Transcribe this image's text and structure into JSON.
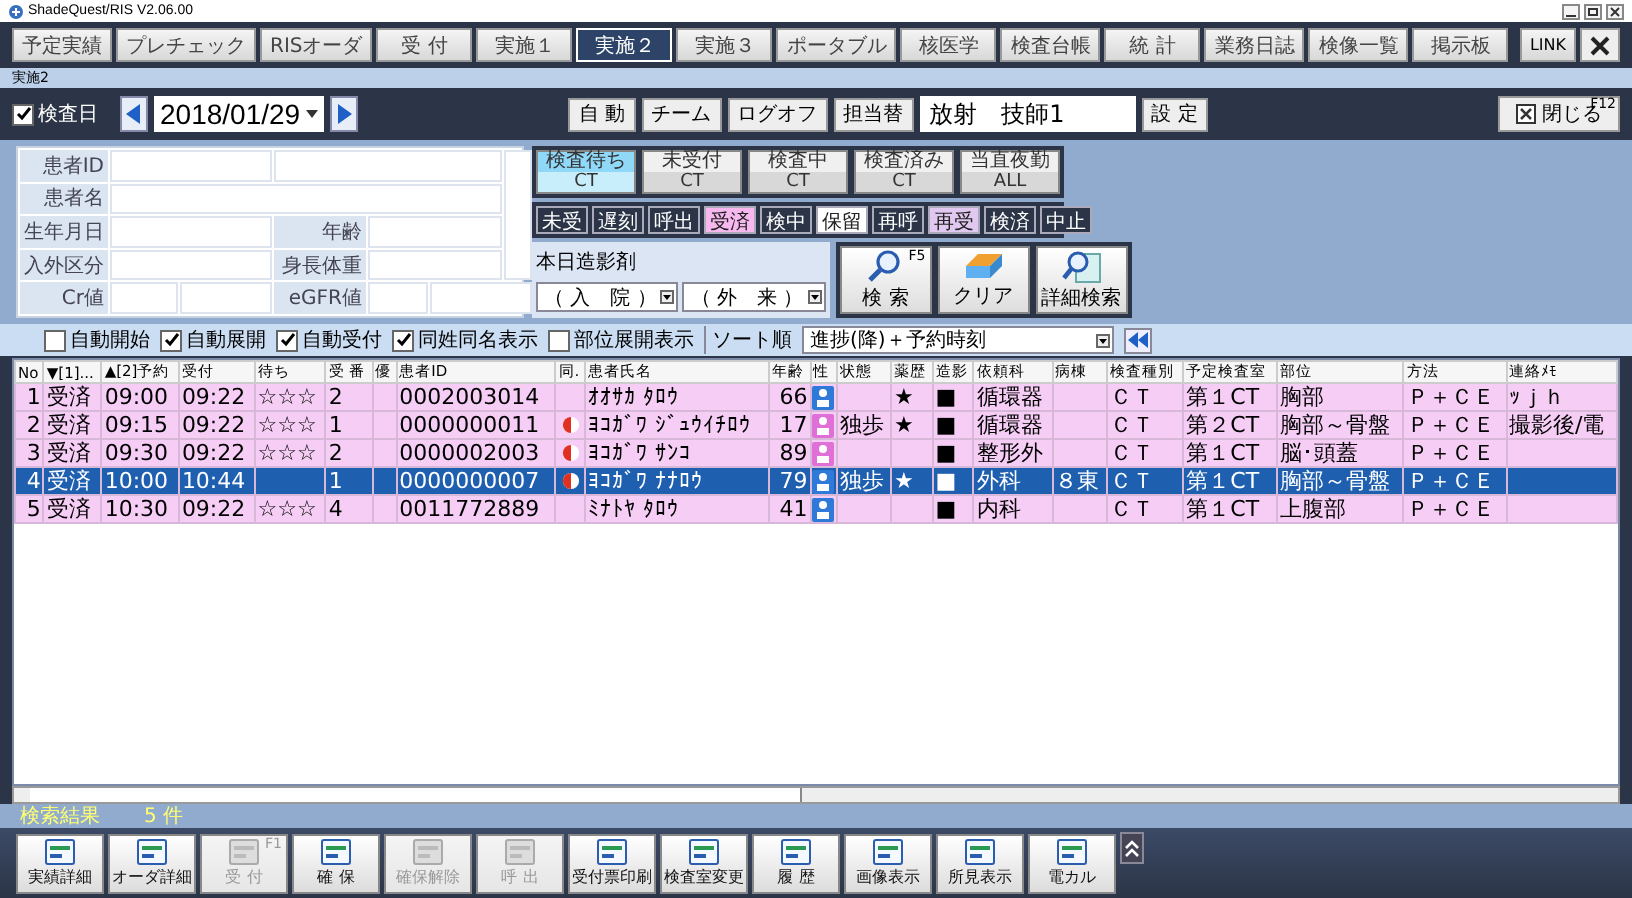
{
  "window": {
    "title": "ShadeQuest/RIS V2.06.00"
  },
  "nav_tabs": [
    {
      "label": "予定実績",
      "selected": false
    },
    {
      "label": "プレチェック",
      "selected": false
    },
    {
      "label": "RISオーダ",
      "selected": false
    },
    {
      "label": "受 付",
      "selected": false
    },
    {
      "label": "実施１",
      "selected": false
    },
    {
      "label": "実施２",
      "selected": true
    },
    {
      "label": "実施３",
      "selected": false
    },
    {
      "label": "ポータブル",
      "selected": false
    },
    {
      "label": "核医学",
      "selected": false
    },
    {
      "label": "検査台帳",
      "selected": false
    },
    {
      "label": "統 計",
      "selected": false
    },
    {
      "label": "業務日誌",
      "selected": false
    },
    {
      "label": "検像一覧",
      "selected": false
    },
    {
      "label": "掲示板",
      "selected": false
    }
  ],
  "link_button": "LINK",
  "screen_title": "実施2",
  "toolbar": {
    "date_checkbox": {
      "label": "検査日",
      "checked": true
    },
    "date": "2018/01/29",
    "buttons": [
      "自 動",
      "チーム",
      "ログオフ",
      "担当替"
    ],
    "operator": "放射　技師1",
    "settings_button": "設 定",
    "close_button": {
      "label": "閉じる",
      "shortcut": "F12"
    }
  },
  "patient_form": {
    "fields": [
      "患者ID",
      "患者名",
      "生年月日",
      "年齢",
      "入外区分",
      "身長体重",
      "Cr値",
      "eGFR値"
    ]
  },
  "status_buttons": [
    {
      "label": "検査待ち",
      "sub": "CT",
      "selected": true
    },
    {
      "label": "未受付",
      "sub": "CT",
      "selected": false
    },
    {
      "label": "検査中",
      "sub": "CT",
      "selected": false
    },
    {
      "label": "検査済み",
      "sub": "CT",
      "selected": false
    },
    {
      "label": "当直夜勤",
      "sub": "ALL",
      "selected": false
    }
  ],
  "filter_buttons": [
    {
      "label": "未受",
      "color": "#2b3547"
    },
    {
      "label": "遅刻",
      "color": "#2b3547"
    },
    {
      "label": "呼出",
      "color": "#2b3547"
    },
    {
      "label": "受済",
      "color": "#f7b8f0"
    },
    {
      "label": "検中",
      "color": "#2b3547"
    },
    {
      "label": "保留",
      "color": "#ffffff"
    },
    {
      "label": "再呼",
      "color": "#2b3547"
    },
    {
      "label": "再受",
      "color": "#e0c8f0"
    },
    {
      "label": "検済",
      "color": "#2b3547"
    },
    {
      "label": "中止",
      "color": "#2b3547"
    }
  ],
  "contrast": {
    "label": "本日造影剤",
    "selects": [
      "（ 入　院 ）",
      "（ 外　来 ）"
    ]
  },
  "search_buttons": [
    {
      "label": "検 索",
      "shortcut": "F5"
    },
    {
      "label": "クリア"
    },
    {
      "label": "詳細検索"
    }
  ],
  "options": [
    {
      "label": "自動開始",
      "checked": false
    },
    {
      "label": "自動展開",
      "checked": true
    },
    {
      "label": "自動受付",
      "checked": true
    },
    {
      "label": "同姓同名表示",
      "checked": true
    },
    {
      "label": "部位展開表示",
      "checked": false
    }
  ],
  "sort": {
    "label": "ソート順",
    "value": "進捗(降)＋予約時刻"
  },
  "table": {
    "columns": [
      "No",
      "▼[1]...",
      "▲[2]予約",
      "受付",
      "待ち",
      "受 番",
      "優",
      "患者ID",
      "同.",
      "患者氏名",
      "年齢",
      "性",
      "状態",
      "薬歴",
      "造影",
      "依頼科",
      "病棟",
      "検査種別",
      "予定検査室",
      "部位",
      "方法",
      "連絡ﾒﾓ"
    ],
    "rows": [
      {
        "no": "1",
        "progress": "受済",
        "reserved": "09:00",
        "received": "09:22",
        "wait": "☆☆☆",
        "number": "2",
        "patient_id": "0002003014",
        "same_name": false,
        "name": "ｵｵｻｶ ﾀﾛｳ",
        "age": "66",
        "kind": "male",
        "state": "",
        "drug_history": "★",
        "contrast": "■",
        "dept": "循環器",
        "ward": "",
        "modality": "ＣＴ",
        "room": "第１CT",
        "region": "胸部",
        "method": "Ｐ＋ＣＥ",
        "note": "ｯｊｈ",
        "selected": false
      },
      {
        "no": "2",
        "progress": "受済",
        "reserved": "09:15",
        "received": "09:22",
        "wait": "☆☆☆",
        "number": "1",
        "patient_id": "0000000011",
        "same_name": true,
        "name": "ﾖｺｶﾞﾜ ｼﾞｭｳｲﾁﾛｳ",
        "age": "17",
        "kind": "female",
        "state": "独歩",
        "drug_history": "★",
        "contrast": "■",
        "dept": "循環器",
        "ward": "",
        "modality": "ＣＴ",
        "room": "第２CT",
        "region": "胸部～骨盤",
        "method": "Ｐ＋ＣＥ",
        "note": "撮影後/電",
        "selected": false
      },
      {
        "no": "3",
        "progress": "受済",
        "reserved": "09:30",
        "received": "09:22",
        "wait": "☆☆☆",
        "number": "2",
        "patient_id": "0000002003",
        "same_name": true,
        "name": "ﾖｺｶﾞﾜ ｻﾝｺ",
        "age": "89",
        "kind": "female",
        "state": "",
        "drug_history": "",
        "contrast": "■",
        "dept": "整形外",
        "ward": "",
        "modality": "ＣＴ",
        "room": "第１CT",
        "region": "脳･頭蓋",
        "method": "Ｐ＋ＣＥ",
        "note": "",
        "selected": false
      },
      {
        "no": "4",
        "progress": "受済",
        "reserved": "10:00",
        "received": "10:44",
        "wait": "",
        "number": "1",
        "patient_id": "0000000007",
        "same_name": true,
        "name": "ﾖｺｶﾞﾜ ﾅﾅﾛｳ",
        "age": "79",
        "kind": "male",
        "state": "独歩",
        "drug_history": "★",
        "contrast": "■",
        "dept": "外科",
        "ward": "８東",
        "modality": "ＣＴ",
        "room": "第１CT",
        "region": "胸部～骨盤",
        "method": "Ｐ＋ＣＥ",
        "note": "",
        "selected": true
      },
      {
        "no": "5",
        "progress": "受済",
        "reserved": "10:30",
        "received": "09:22",
        "wait": "☆☆☆",
        "number": "4",
        "patient_id": "0011772889",
        "same_name": false,
        "name": "ﾐﾅﾄﾔ ﾀﾛｳ",
        "age": "41",
        "kind": "male",
        "state": "",
        "drug_history": "",
        "contrast": "■",
        "dept": "内科",
        "ward": "",
        "modality": "ＣＴ",
        "room": "第１CT",
        "region": "上腹部",
        "method": "Ｐ＋ＣＥ",
        "note": "",
        "selected": false
      }
    ]
  },
  "status_bar": {
    "label": "検索結果",
    "count": "5 件"
  },
  "bottom_buttons": [
    {
      "label": "実績詳細",
      "disabled": false
    },
    {
      "label": "オーダ詳細",
      "disabled": false
    },
    {
      "label": "受 付",
      "shortcut": "F1",
      "disabled": true
    },
    {
      "label": "確 保",
      "disabled": false
    },
    {
      "label": "確保解除",
      "disabled": true
    },
    {
      "label": "呼 出",
      "disabled": true
    },
    {
      "label": "受付票印刷",
      "disabled": false
    },
    {
      "label": "検査室変更",
      "disabled": false
    },
    {
      "label": "履 歴",
      "disabled": false
    },
    {
      "label": "画像表示",
      "disabled": false
    },
    {
      "label": "所見表示",
      "disabled": false
    },
    {
      "label": "電カル",
      "disabled": false
    }
  ]
}
